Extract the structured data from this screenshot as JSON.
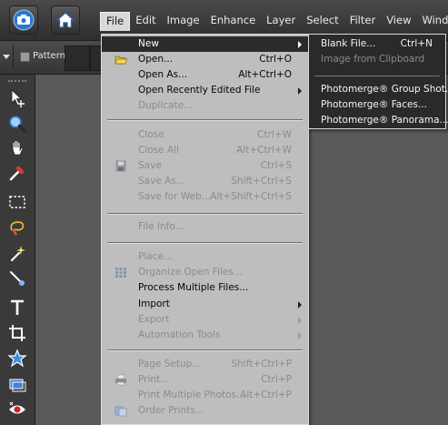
{
  "menubar": {
    "items": [
      "File",
      "Edit",
      "Image",
      "Enhance",
      "Layer",
      "Select",
      "Filter",
      "View",
      "Window"
    ],
    "active": "File"
  },
  "options": {
    "pattern_label": "Pattern"
  },
  "file_menu": {
    "items": [
      {
        "label": "New",
        "shortcut": "",
        "submenu": true,
        "enabled": true,
        "highlighted": true
      },
      {
        "label": "Open...",
        "shortcut": "Ctrl+O",
        "enabled": true,
        "icon": "folder-icon"
      },
      {
        "label": "Open As...",
        "shortcut": "Alt+Ctrl+O",
        "enabled": true
      },
      {
        "label": "Open Recently Edited File",
        "shortcut": "",
        "submenu": true,
        "enabled": true
      },
      {
        "label": "Duplicate...",
        "shortcut": "",
        "enabled": false
      },
      {
        "label": "Close",
        "shortcut": "Ctrl+W",
        "enabled": false
      },
      {
        "label": "Close All",
        "shortcut": "Alt+Ctrl+W",
        "enabled": false
      },
      {
        "label": "Save",
        "shortcut": "Ctrl+S",
        "enabled": false,
        "icon": "save-icon"
      },
      {
        "label": "Save As...",
        "shortcut": "Shift+Ctrl+S",
        "enabled": false
      },
      {
        "label": "Save for Web...",
        "shortcut": "Alt+Shift+Ctrl+S",
        "enabled": false
      },
      {
        "label": "File Info...",
        "shortcut": "",
        "enabled": false
      },
      {
        "label": "Place...",
        "shortcut": "",
        "enabled": false
      },
      {
        "label": "Organize Open Files...",
        "shortcut": "",
        "enabled": false,
        "icon": "organize-icon"
      },
      {
        "label": "Process Multiple Files...",
        "shortcut": "",
        "enabled": true
      },
      {
        "label": "Import",
        "shortcut": "",
        "submenu": true,
        "enabled": true
      },
      {
        "label": "Export",
        "shortcut": "",
        "submenu": true,
        "enabled": false
      },
      {
        "label": "Automation Tools",
        "shortcut": "",
        "submenu": true,
        "enabled": false
      },
      {
        "label": "Page Setup...",
        "shortcut": "Shift+Ctrl+P",
        "enabled": false
      },
      {
        "label": "Print...",
        "shortcut": "Ctrl+P",
        "enabled": false,
        "icon": "print-icon"
      },
      {
        "label": "Print Multiple Photos...",
        "shortcut": "Alt+Ctrl+P",
        "enabled": false
      },
      {
        "label": "Order Prints...",
        "shortcut": "",
        "enabled": false,
        "icon": "order-prints-icon"
      }
    ]
  },
  "new_submenu": {
    "items": [
      {
        "label": "Blank File...",
        "shortcut": "Ctrl+N",
        "enabled": true
      },
      {
        "label": "Image from Clipboard",
        "shortcut": "",
        "enabled": false
      },
      {
        "label": "Photomerge® Group Shot...",
        "shortcut": "",
        "enabled": true
      },
      {
        "label": "Photomerge® Faces...",
        "shortcut": "",
        "enabled": true
      },
      {
        "label": "Photomerge® Panorama...",
        "shortcut": "",
        "enabled": true
      }
    ]
  },
  "toolbox": {
    "tools": [
      "move-tool-icon",
      "zoom-tool-icon",
      "hand-tool-icon",
      "eyedropper-tool-icon",
      "marquee-tool-icon",
      "lasso-tool-icon",
      "magic-wand-tool-icon",
      "selection-brush-tool-icon",
      "type-tool-icon",
      "crop-tool-icon",
      "cookie-cutter-tool-icon",
      "straighten-tool-icon",
      "red-eye-tool-icon"
    ]
  },
  "colors": {
    "menu_bg": "#bebebe",
    "highlight_bg": "#2b2b2b",
    "disabled_text": "#8b8b8b",
    "canvas_bg": "#595959"
  }
}
